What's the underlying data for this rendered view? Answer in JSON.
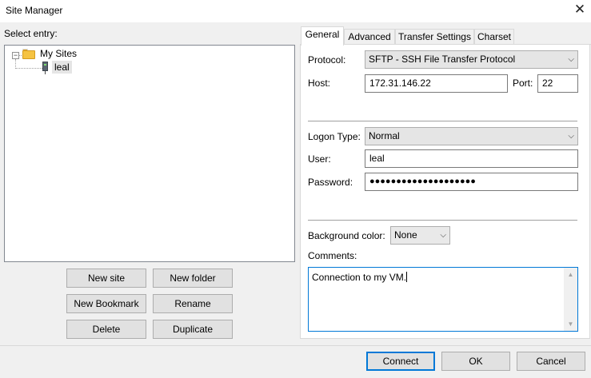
{
  "window": {
    "title": "Site Manager",
    "close_glyph": "✕"
  },
  "left": {
    "select_entry_label": "Select entry:",
    "tree": {
      "root": {
        "label": "My Sites",
        "icon": "folder-icon",
        "expander": "−"
      },
      "children": [
        {
          "label": "leal",
          "icon": "server-icon"
        }
      ]
    },
    "buttons": {
      "new_site": "New site",
      "new_folder": "New folder",
      "new_bookmark": "New Bookmark",
      "rename": "Rename",
      "delete": "Delete",
      "duplicate": "Duplicate"
    }
  },
  "tabs": [
    {
      "label": "General",
      "active": true
    },
    {
      "label": "Advanced",
      "active": false
    },
    {
      "label": "Transfer Settings",
      "active": false
    },
    {
      "label": "Charset",
      "active": false
    }
  ],
  "general": {
    "protocol_label": "Protocol:",
    "protocol_value": "SFTP - SSH File Transfer Protocol",
    "host_label": "Host:",
    "host_value": "172.31.146.22",
    "port_label": "Port:",
    "port_value": "22",
    "logon_type_label": "Logon Type:",
    "logon_type_value": "Normal",
    "user_label": "User:",
    "user_value": "leal",
    "password_label": "Password:",
    "password_value": "●●●●●●●●●●●●●●●●●●●●",
    "background_color_label": "Background color:",
    "background_color_value": "None",
    "comments_label": "Comments:",
    "comments_value": "Connection to my VM."
  },
  "footer": {
    "connect": "Connect",
    "ok": "OK",
    "cancel": "Cancel"
  },
  "glyphs": {
    "dropdown": "⌵",
    "scroll_up": "▲",
    "scroll_down": "▼"
  },
  "colors": {
    "accent": "#0078d7",
    "window_bg": "#f0f0f0",
    "panel_bg": "#ffffff"
  }
}
